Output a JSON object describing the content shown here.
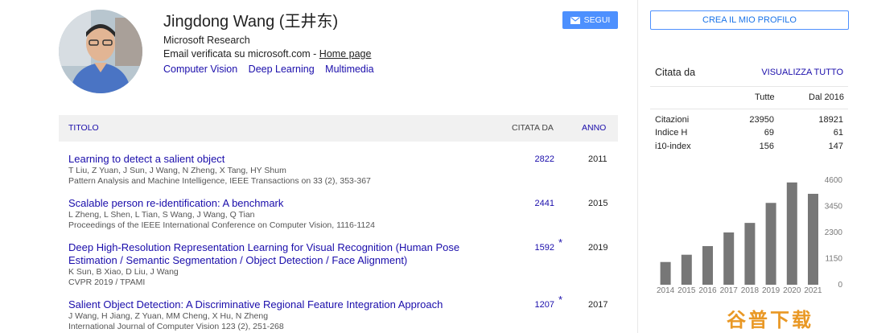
{
  "profile": {
    "name": "Jingdong Wang (王井东)",
    "affiliation": "Microsoft Research",
    "email_text": "Email verificata su microsoft.com - ",
    "homepage_label": "Home page",
    "interests": [
      "Computer Vision",
      "Deep Learning",
      "Multimedia"
    ]
  },
  "follow_label": "SEGUI",
  "table": {
    "col_title": "TITOLO",
    "col_cited": "CITATA DA",
    "col_year": "ANNO",
    "rows": [
      {
        "title": "Learning to detect a salient object",
        "authors": "T Liu, Z Yuan, J Sun, J Wang, N Zheng, X Tang, HY Shum",
        "venue": "Pattern Analysis and Machine Intelligence, IEEE Transactions on 33 (2), 353-367",
        "cited": "2822",
        "star": "",
        "year": "2011"
      },
      {
        "title": "Scalable person re-identification: A benchmark",
        "authors": "L Zheng, L Shen, L Tian, S Wang, J Wang, Q Tian",
        "venue": "Proceedings of the IEEE International Conference on Computer Vision, 1116-1124",
        "cited": "2441",
        "star": "",
        "year": "2015"
      },
      {
        "title": "Deep High-Resolution Representation Learning for Visual Recognition (Human Pose Estimation / Semantic Segmentation / Object Detection / Face Alignment)",
        "authors": "K Sun, B Xiao, D Liu, J Wang",
        "venue": "CVPR 2019 / TPAMI",
        "cited": "1592",
        "star": "*",
        "year": "2019"
      },
      {
        "title": "Salient Object Detection: A Discriminative Regional Feature Integration Approach",
        "authors": "J Wang, H Jiang, Z Yuan, MM Cheng, X Hu, N Zheng",
        "venue": "International Journal of Computer Vision 123 (2), 251-268",
        "cited": "1207",
        "star": "*",
        "year": "2017"
      }
    ]
  },
  "sidebar": {
    "create_profile_label": "CREA IL MIO PROFILO",
    "cited_by_heading": "Citata da",
    "view_all_label": "VISUALIZZA TUTTO",
    "col_all": "Tutte",
    "col_since": "Dal 2016",
    "stats": [
      {
        "label": "Citazioni",
        "all": "23950",
        "since": "18921"
      },
      {
        "label": "Indice H",
        "all": "69",
        "since": "61"
      },
      {
        "label": "i10-index",
        "all": "156",
        "since": "147"
      }
    ]
  },
  "chart_data": {
    "type": "bar",
    "categories": [
      "2014",
      "2015",
      "2016",
      "2017",
      "2018",
      "2019",
      "2020",
      "2021"
    ],
    "values": [
      1000,
      1320,
      1700,
      2300,
      2720,
      3600,
      4500,
      4000
    ],
    "yticks": [
      "0",
      "1150",
      "2300",
      "3450",
      "4600"
    ],
    "ylim": [
      0,
      4600
    ],
    "bar_color": "#777777",
    "axis_side": "right"
  },
  "watermark": "谷普下载",
  "colors": {
    "link": "#1a0dab",
    "button": "#4d90fe",
    "header_bg": "#f1f1f1"
  }
}
